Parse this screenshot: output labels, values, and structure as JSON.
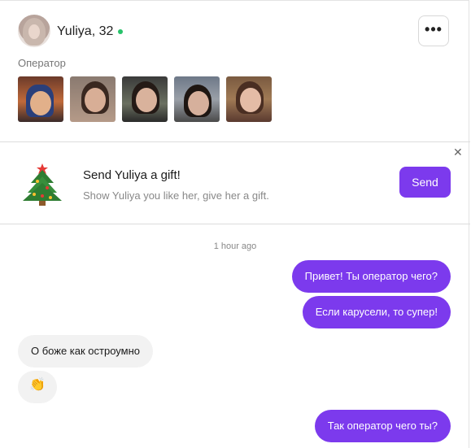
{
  "profile": {
    "name": "Yuliya, 32",
    "role": "Оператор",
    "online_color": "#27c26a",
    "menu_icon": "more-horizontal-icon"
  },
  "gift": {
    "title": "Send Yuliya a gift!",
    "subtitle": "Show Yuliya you like her, give her a gift.",
    "send_label": "Send",
    "close_icon": "close-icon",
    "icon": "christmas-tree-icon"
  },
  "chat": {
    "timestamp": "1 hour ago",
    "messages": [
      {
        "from": "me",
        "text": "Привет! Ты оператор чего?"
      },
      {
        "from": "me",
        "text": "Если карусели, то супер!"
      },
      {
        "from": "her",
        "text": "О боже как остроумно"
      },
      {
        "from": "her",
        "text": "👏"
      },
      {
        "from": "me",
        "text": "Так оператор чего ты?"
      }
    ]
  },
  "colors": {
    "accent": "#7c3aed",
    "incoming_bubble": "#f2f2f2"
  }
}
